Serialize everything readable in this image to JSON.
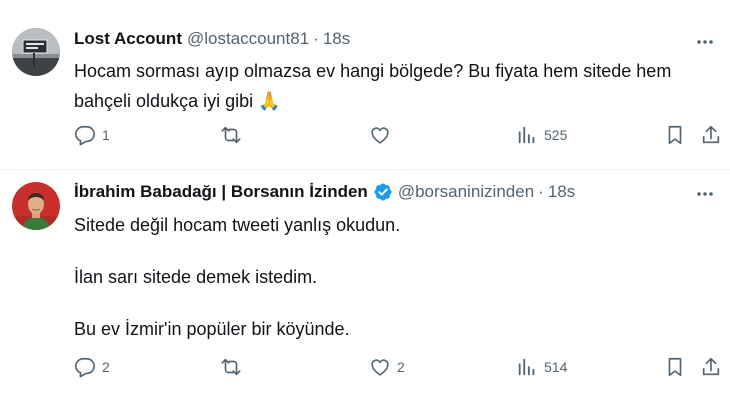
{
  "tweets": [
    {
      "author_name": "Lost Account",
      "handle": "@lostaccount81",
      "separator": "·",
      "time": "18s",
      "verified": false,
      "avatar_icon": "road-sign-avatar",
      "text": [
        "Hocam sorması ayıp olmazsa ev hangi bölgede? Bu fiyata hem sitede hem bahçeli oldukça iyi gibi 🙏"
      ],
      "replies": "1",
      "reposts": "",
      "likes": "",
      "views": "525"
    },
    {
      "author_name": "İbrahim Babadağı | Borsanın İzinden",
      "handle": "@borsaninizinden",
      "separator": "·",
      "time": "18s",
      "verified": true,
      "avatar_icon": "person-avatar",
      "text": [
        "Sitede değil hocam tweeti yanlış okudun.",
        "İlan sarı sitede demek istedim.",
        "Bu ev İzmir'in popüler bir köyünde."
      ],
      "replies": "2",
      "reposts": "",
      "likes": "2",
      "views": "514"
    }
  ],
  "colors": {
    "text": "#0f1419",
    "muted": "#536471",
    "verified": "#1d9bf0",
    "divider": "#eff3f4"
  }
}
